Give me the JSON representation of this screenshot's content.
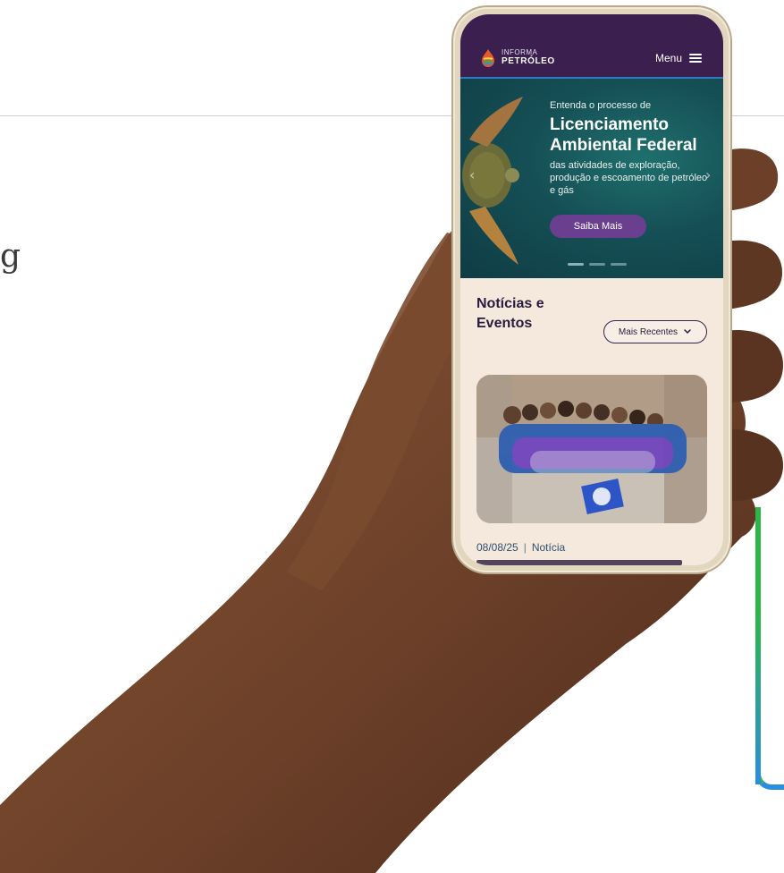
{
  "page": {
    "clipped_text": "g"
  },
  "header": {
    "logo_top": "INFORMA",
    "logo_bottom": "PETRÓLEO",
    "menu_label": "Menu",
    "menu_icon": "hamburger-icon"
  },
  "hero": {
    "kicker": "Entenda o processo de",
    "title": "Licenciamento Ambiental Federal",
    "description": "das atividades de exploração, produção e escoamento de petróleo e gás",
    "cta_label": "Saiba Mais",
    "slides_count": 3,
    "active_slide_index": 0
  },
  "news": {
    "section_title": "Notícias e Eventos",
    "filter_label": "Mais Recentes",
    "items": [
      {
        "date": "08/08/25",
        "category": "Notícia"
      }
    ]
  },
  "colors": {
    "header_bg": "#3b1f4f",
    "hero_bg": "#154f55",
    "cta_bg": "#6a3f8f",
    "section_bg": "#f4e9dc",
    "accent_green": "#2cb64a",
    "accent_blue": "#2b8de0"
  }
}
